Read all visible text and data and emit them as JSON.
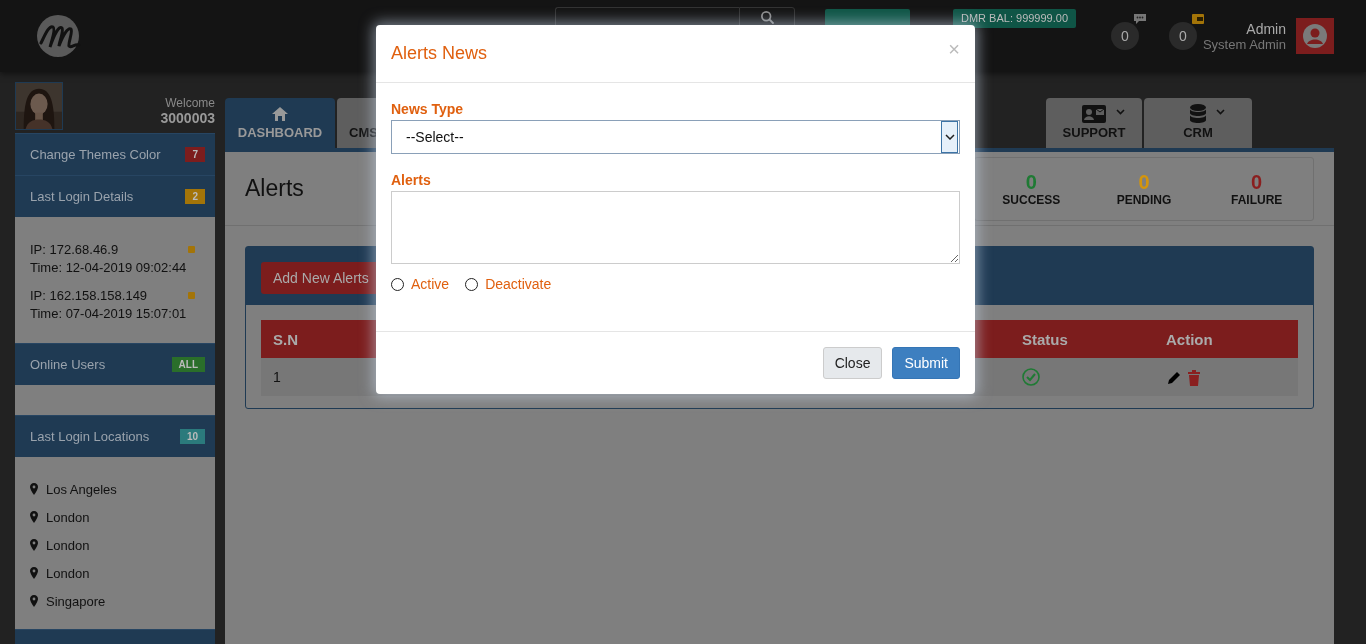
{
  "header": {
    "balances": [
      {
        "kind": "hidden"
      },
      {
        "label": "DMR BAL: 999999.00"
      }
    ],
    "notifications": [
      {
        "count": "0",
        "kind": "message"
      },
      {
        "count": "0",
        "kind": "wallet"
      }
    ],
    "user": {
      "name": "Admin",
      "role": "System Admin"
    }
  },
  "sidebar": {
    "welcome": "Welcome",
    "user_id": "3000003",
    "panels": [
      {
        "title": "Change Themes Color",
        "badge": "7",
        "color": "#7c1d1d",
        "kind": "plain"
      },
      {
        "title": "Last Login Details",
        "badge": "2",
        "color": "#a37408",
        "kind": "logins",
        "entries": [
          {
            "ip": "IP: 172.68.46.9",
            "time": "Time: 12-04-2019 09:02:44",
            "color": "#a37408"
          },
          {
            "ip": "IP: 162.158.158.149",
            "time": "Time: 07-04-2019 15:07:01",
            "color": "#a37408"
          }
        ]
      },
      {
        "title": "Online Users",
        "badge": "ALL",
        "color": "#2a6e2a",
        "kind": "empty"
      },
      {
        "title": "Last Login Locations",
        "badge": "10",
        "color": "#2b7a7c",
        "kind": "locations",
        "locations": [
          "Los Angeles",
          "London",
          "London",
          "London",
          "Singapore"
        ]
      }
    ]
  },
  "tabs": [
    {
      "label": "DASHBOARD",
      "kind": "home",
      "selected": true
    },
    {
      "label": "CMS",
      "kind": "plain",
      "selected": false
    },
    {
      "label": "SUPPORT",
      "kind": "card",
      "dropdown": true,
      "selected": false
    },
    {
      "label": "CRM",
      "kind": "database",
      "dropdown": true,
      "selected": false
    }
  ],
  "page": {
    "title": "Alerts",
    "stats": [
      {
        "value": "0",
        "label": "SUCCESS",
        "color": "#1f7a34"
      },
      {
        "value": "0",
        "label": "PENDING",
        "color": "#d4950c"
      },
      {
        "value": "0",
        "label": "FAILURE",
        "color": "#8a1f1f"
      }
    ],
    "add_button": "Add New Alerts",
    "table": {
      "columns": [
        {
          "label": "S.N"
        },
        {},
        {
          "label": "Status"
        },
        {
          "label": "Action"
        }
      ],
      "rows": [
        {
          "sn": "1",
          "active": true
        }
      ]
    }
  },
  "modal": {
    "title": "Alerts News",
    "close": "×",
    "fields": [
      {
        "kind": "select",
        "label": "News Type",
        "value": "--Select--"
      },
      {
        "kind": "textarea",
        "label": "Alerts"
      }
    ],
    "radios": [
      {
        "label": "Active",
        "selected": false
      },
      {
        "label": "Deactivate",
        "selected": false
      }
    ],
    "buttons": [
      {
        "label": "Close",
        "kind": "secondary"
      },
      {
        "label": "Submit",
        "kind": "primary"
      }
    ]
  }
}
